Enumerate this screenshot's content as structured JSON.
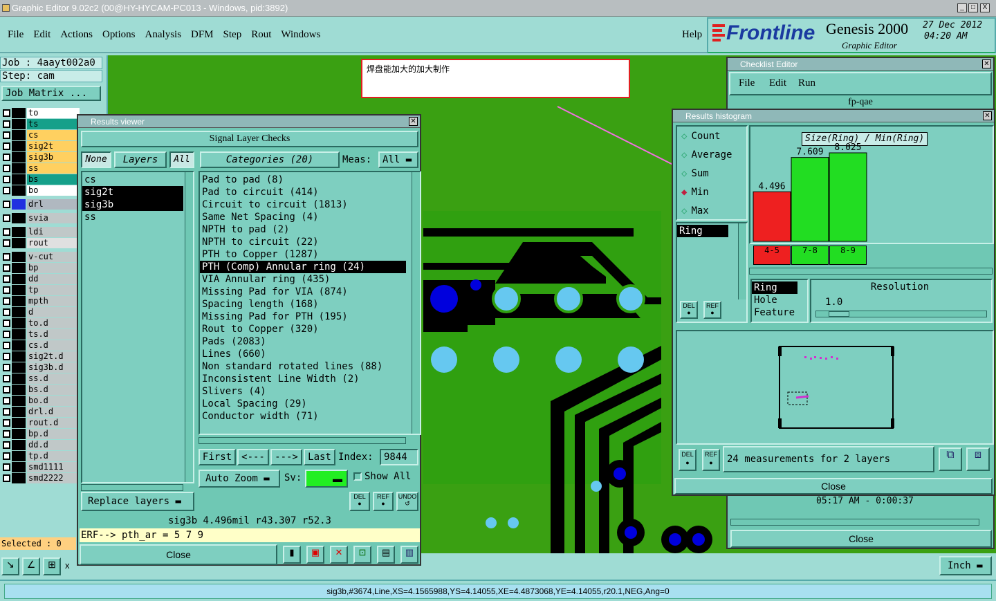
{
  "window": {
    "title": "Graphic Editor 9.02c2 (00@HY-HYCAM-PC013 - Windows, pid:3892)",
    "controls": [
      "_",
      "□",
      "X"
    ]
  },
  "menu": [
    "File",
    "Edit",
    "Actions",
    "Options",
    "Analysis",
    "DFM",
    "Step",
    "Rout",
    "Windows"
  ],
  "help": "Help",
  "logo": {
    "brand": "Frontline",
    "product": "Genesis 2000",
    "subtitle": "Graphic Editor",
    "date": "27 Dec 2012",
    "time": "04:20 AM"
  },
  "left": {
    "job": "Job : 4aayt002a0",
    "step": "Step: cam",
    "job_matrix": "Job Matrix ...",
    "selected": "Selected : 0",
    "layers": [
      {
        "name": "to",
        "color": "#ffffff"
      },
      {
        "name": "ts",
        "color": "#16a08a"
      },
      {
        "name": "cs",
        "color": "#ffd060"
      },
      {
        "name": "sig2t",
        "color": "#ffd060"
      },
      {
        "name": "sig3b",
        "color": "#ffd060"
      },
      {
        "name": "ss",
        "color": "#ffd060"
      },
      {
        "name": "bs",
        "color": "#16a08a"
      },
      {
        "name": "bo",
        "color": "#ffffff"
      },
      {
        "name": "drl",
        "color": "#b0b8c0"
      },
      {
        "name": "svia",
        "color": "#c0c8c8"
      },
      {
        "name": "ldi",
        "color": "#c0c8c8"
      },
      {
        "name": "rout",
        "color": "#e0e0e0"
      },
      {
        "name": "v-cut",
        "color": "#c0c8c8"
      },
      {
        "name": "bp",
        "color": "#c0c8c8"
      },
      {
        "name": "dd",
        "color": "#c0c8c8"
      },
      {
        "name": "tp",
        "color": "#c0c8c8"
      },
      {
        "name": "mpth",
        "color": "#c0c8c8"
      },
      {
        "name": "d",
        "color": "#c0c8c8"
      },
      {
        "name": "to.d",
        "color": "#c0c8c8"
      },
      {
        "name": "ts.d",
        "color": "#c0c8c8"
      },
      {
        "name": "cs.d",
        "color": "#c0c8c8"
      },
      {
        "name": "sig2t.d",
        "color": "#c0c8c8"
      },
      {
        "name": "sig3b.d",
        "color": "#c0c8c8"
      },
      {
        "name": "ss.d",
        "color": "#c0c8c8"
      },
      {
        "name": "bs.d",
        "color": "#c0c8c8"
      },
      {
        "name": "bo.d",
        "color": "#c0c8c8"
      },
      {
        "name": "drl.d",
        "color": "#c0c8c8"
      },
      {
        "name": "rout.d",
        "color": "#c0c8c8"
      },
      {
        "name": "bp.d",
        "color": "#c0c8c8"
      },
      {
        "name": "dd.d",
        "color": "#c0c8c8"
      },
      {
        "name": "tp.d",
        "color": "#c0c8c8"
      },
      {
        "name": "smd1111",
        "color": "#c0c8c8"
      },
      {
        "name": "smd2222",
        "color": "#c0c8c8"
      }
    ]
  },
  "annotation": "焊盘能加大的加大制作",
  "results_viewer": {
    "title": "Results viewer",
    "header": "Signal Layer Checks",
    "none": "None",
    "layers_label": "Layers",
    "all": "All",
    "categories_label": "Categories (20)",
    "meas_label": "Meas:",
    "meas_value": "All",
    "layer_list": [
      "cs",
      "sig2t",
      "sig3b",
      "ss"
    ],
    "categories": [
      "Pad to pad (8)",
      "Pad to circuit (414)",
      "Circuit to circuit (1813)",
      "Same Net Spacing (4)",
      "NPTH to pad (2)",
      "NPTH to circuit (22)",
      "PTH to Copper (1287)",
      "PTH (Comp) Annular ring (24)",
      "VIA Annular ring (435)",
      "Missing Pad for VIA (874)",
      "Spacing length (168)",
      "Missing Pad for PTH (195)",
      "Rout to Copper (320)",
      "Pads (2083)",
      "Lines (660)",
      "Non standard rotated lines (88)",
      "Inconsistent Line Width (2)",
      "Slivers (4)",
      "Local Spacing (29)",
      "Conductor width (71)"
    ],
    "first": "First",
    "prev": "<---",
    "next": "--->",
    "last": "Last",
    "index_label": "Index:",
    "index_value": "9844",
    "auto_zoom": "Auto Zoom",
    "sv_label": "Sv:",
    "show_all": "Show All",
    "replace_layers": "Replace layers",
    "del": "DEL",
    "ref": "REF",
    "undo": "UNDO",
    "info": "sig3b 4.496mil  r43.307  r52.3",
    "erf": "ERF--> pth_ar = 5 7 9",
    "close": "Close"
  },
  "checklist": {
    "title": "Checklist Editor",
    "menu": [
      "File",
      "Edit",
      "Run"
    ],
    "name": "fp-qae",
    "time": "05:17 AM - 0:00:37",
    "close": "Close"
  },
  "histogram": {
    "title": "Results histogram",
    "options": [
      "Count",
      "Average",
      "Sum",
      "Min",
      "Max"
    ],
    "selected_option": "Min",
    "chart_title": "Size(Ring) / Min(Ring)",
    "ring_list": [
      "Ring"
    ],
    "sort_list": [
      "Ring",
      "Hole",
      "Feature"
    ],
    "resolution_label": "Resolution",
    "resolution_value": "1.0",
    "summary": "24 measurements for 2 layers",
    "close": "Close",
    "del": "DEL",
    "ref": "REF"
  },
  "chart_data": {
    "type": "bar",
    "title": "Size(Ring) / Min(Ring)",
    "categories": [
      "4-5",
      "7-8",
      "8-9"
    ],
    "values": [
      4.496,
      7.609,
      8.025
    ],
    "colors": [
      "#ee2020",
      "#22dd22",
      "#22dd22"
    ]
  },
  "units": "Inch",
  "status_text": "sig3b,#3674,Line,XS=4.1565988,YS=4.14055,XE=4.4873068,YE=4.14055,r20.1,NEG,Ang=0"
}
